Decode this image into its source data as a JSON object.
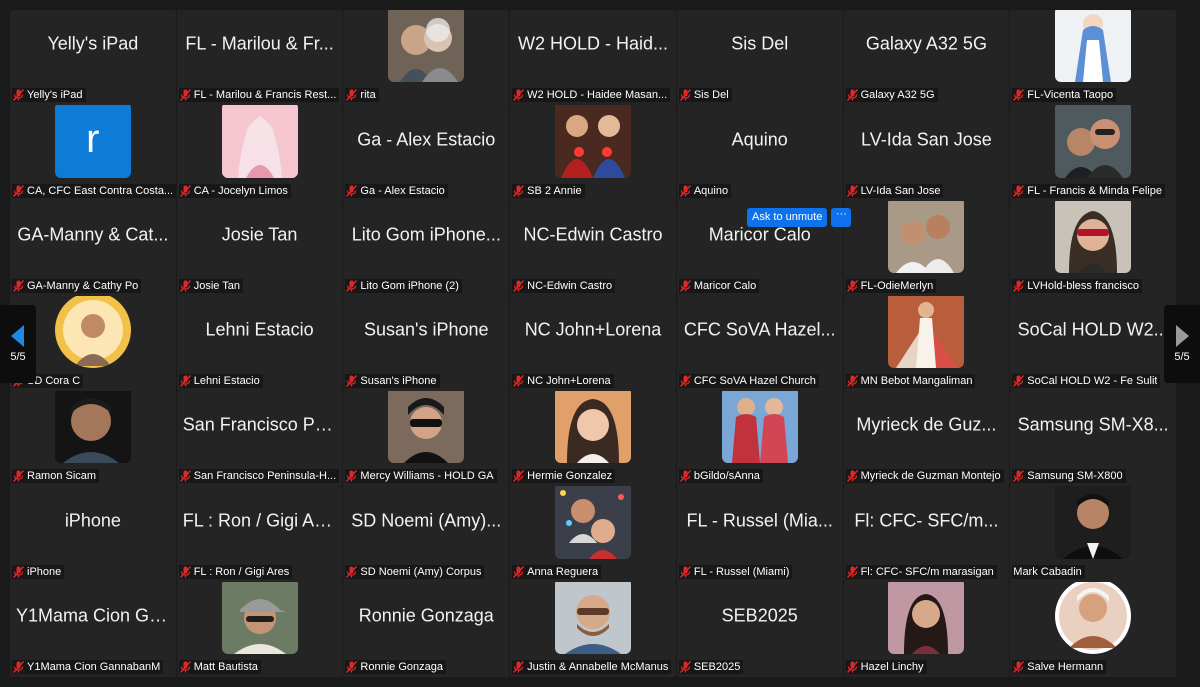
{
  "colors": {
    "accent": "#0e72ed",
    "tile": "#242424",
    "background": "#1a1a1a",
    "muted_icon": "#e02828"
  },
  "page_nav": {
    "left_label": "5/5",
    "right_label": "5/5"
  },
  "overlay": {
    "ask_to_unmute": "Ask to unmute",
    "more": "···"
  },
  "tiles": [
    {
      "kind": "name",
      "big": "Yelly's iPad",
      "label": "Yelly's iPad"
    },
    {
      "kind": "name",
      "big": "FL - Marilou & Fr...",
      "label": "FL - Marilou & Francis Rest..."
    },
    {
      "kind": "photo",
      "photo": "elderly-couple",
      "label": "rita"
    },
    {
      "kind": "name",
      "big": "W2 HOLD - Haid...",
      "label": "W2 HOLD - Haidee Masan..."
    },
    {
      "kind": "name",
      "big": "Sis Del",
      "label": "Sis Del"
    },
    {
      "kind": "name",
      "big": "Galaxy A32 5G",
      "label": "Galaxy A32 5G"
    },
    {
      "kind": "photo",
      "photo": "virgin-mary-statue",
      "label": "FL-Vicenta Taopo"
    },
    {
      "kind": "letter",
      "letter": "r",
      "label": "CA, CFC East Contra Costa..."
    },
    {
      "kind": "photo",
      "photo": "virgin-mary-pink",
      "label": "CA - Jocelyn Limos"
    },
    {
      "kind": "name",
      "big": "Ga - Alex Estacio",
      "label": "Ga - Alex Estacio"
    },
    {
      "kind": "photo",
      "photo": "sacred-hearts",
      "label": "SB 2 Annie"
    },
    {
      "kind": "name",
      "big": "Aquino",
      "label": "Aquino"
    },
    {
      "kind": "name",
      "big": "LV-Ida San Jose",
      "label": "LV-Ida San Jose"
    },
    {
      "kind": "photo",
      "photo": "couple-selfie",
      "label": "FL - Francis & Minda Felipe"
    },
    {
      "kind": "name",
      "big": "GA-Manny & Cat...",
      "label": "GA-Manny & Cathy Po"
    },
    {
      "kind": "name",
      "big": "Josie Tan",
      "label": "Josie Tan"
    },
    {
      "kind": "name",
      "big": "Lito Gom iPhone...",
      "label": "Lito Gom iPhone (2)"
    },
    {
      "kind": "name",
      "big": "NC-Edwin Castro",
      "label": "NC-Edwin Castro"
    },
    {
      "kind": "name",
      "big": "Maricor Calo",
      "label": "Maricor Calo"
    },
    {
      "kind": "photo",
      "photo": "couple-formal",
      "label": "FL-OdieMerlyn"
    },
    {
      "kind": "photo",
      "photo": "woman-glasses",
      "label": "LVHold-bless francisco"
    },
    {
      "kind": "photo",
      "photo": "woman-portrait-round",
      "label": "SD Cora C"
    },
    {
      "kind": "name",
      "big": "Lehni Estacio",
      "label": "Lehni Estacio"
    },
    {
      "kind": "name",
      "big": "Susan's iPhone",
      "label": "Susan's iPhone"
    },
    {
      "kind": "name",
      "big": "NC John+Lorena",
      "label": "NC John+Lorena"
    },
    {
      "kind": "name",
      "big": "CFC SoVA Hazel...",
      "label": "CFC SoVA Hazel Church"
    },
    {
      "kind": "photo",
      "photo": "divine-mercy",
      "label": "MN Bebot Mangaliman"
    },
    {
      "kind": "name",
      "big": "SoCal HOLD W2...",
      "label": "SoCal HOLD W2 - Fe Sulit"
    },
    {
      "kind": "photo",
      "photo": "man-portrait",
      "label": "Ramon Sicam"
    },
    {
      "kind": "name",
      "big": "San Francisco Pe...",
      "label": "San Francisco Peninsula-H..."
    },
    {
      "kind": "photo",
      "photo": "woman-car",
      "label": "Mercy Williams - HOLD GA"
    },
    {
      "kind": "photo",
      "photo": "woman-smiling",
      "label": "Hermie Gonzalez"
    },
    {
      "kind": "photo",
      "photo": "two-hearts",
      "label": "bGildo/sAnna"
    },
    {
      "kind": "name",
      "big": "Myrieck de Guz...",
      "label": "Myrieck de Guzman Montejo"
    },
    {
      "kind": "name",
      "big": "Samsung SM-X8...",
      "label": "Samsung SM-X800"
    },
    {
      "kind": "name",
      "big": "iPhone",
      "label": "iPhone"
    },
    {
      "kind": "name",
      "big": "FL : Ron / Gigi Ares",
      "label": "FL : Ron / Gigi Ares"
    },
    {
      "kind": "name",
      "big": "SD Noemi (Amy)...",
      "label": "SD Noemi (Amy) Corpus"
    },
    {
      "kind": "photo",
      "photo": "couple-christmas",
      "label": "Anna Reguera"
    },
    {
      "kind": "name",
      "big": "FL - Russel (Mia...",
      "label": "FL - Russel (Miami)"
    },
    {
      "kind": "name",
      "big": "Fl: CFC- SFC/m...",
      "label": "Fl: CFC- SFC/m marasigan"
    },
    {
      "kind": "photo",
      "photo": "man-dark-bg",
      "label": "Mark Cabadin",
      "unmuted": true
    },
    {
      "kind": "name",
      "big": "Y1Mama Cion Ga...",
      "label": "Y1Mama Cion GannabanM"
    },
    {
      "kind": "photo",
      "photo": "man-cap",
      "label": "Matt Bautista"
    },
    {
      "kind": "name",
      "big": "Ronnie Gonzaga",
      "label": "Ronnie Gonzaga"
    },
    {
      "kind": "photo",
      "photo": "man-glasses",
      "label": "Justin & Annabelle McManus"
    },
    {
      "kind": "name",
      "big": "SEB2025",
      "label": "SEB2025"
    },
    {
      "kind": "photo",
      "photo": "woman-outdoor",
      "label": "Hazel Linchy"
    },
    {
      "kind": "photo",
      "photo": "woman-round-art",
      "label": "Salve Hermann"
    }
  ]
}
